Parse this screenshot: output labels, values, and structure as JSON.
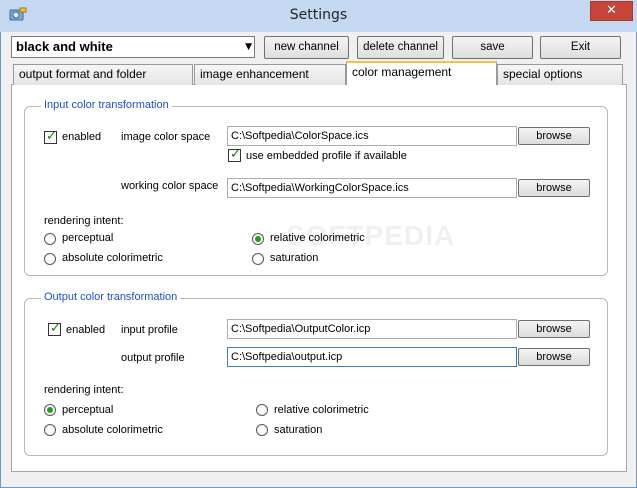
{
  "window": {
    "title": "Settings",
    "close_label": "✕"
  },
  "toolbar": {
    "channel_value": "black and white",
    "new_channel": "new channel",
    "delete_channel": "delete channel",
    "save": "save",
    "exit": "Exit"
  },
  "tabs": [
    {
      "label": "output format and folder",
      "active": false
    },
    {
      "label": "image enhancement",
      "active": false
    },
    {
      "label": "color management",
      "active": true
    },
    {
      "label": "special options",
      "active": false
    }
  ],
  "input_group": {
    "legend": "Input color transformation",
    "enabled_label": "enabled",
    "enabled_checked": true,
    "image_color_space_label": "image color space",
    "image_color_space_value": "C:\\Softpedia\\ColorSpace.ics",
    "use_embedded_label": "use embedded profile if available",
    "use_embedded_checked": true,
    "working_color_space_label": "working color space",
    "working_color_space_value": "C:\\Softpedia\\WorkingColorSpace.ics",
    "browse_label": "browse",
    "rendering_intent_label": "rendering intent:",
    "intents": {
      "perceptual": "perceptual",
      "relative": "relative colorimetric",
      "absolute": "absolute colorimetric",
      "saturation": "saturation"
    },
    "selected_intent": "relative colorimetric"
  },
  "output_group": {
    "legend": "Output color transformation",
    "enabled_label": "enabled",
    "enabled_checked": true,
    "input_profile_label": "input profile",
    "input_profile_value": "C:\\Softpedia\\OutputColor.icp",
    "output_profile_label": "output profile",
    "output_profile_value": "C:\\Softpedia\\output.icp",
    "browse_label": "browse",
    "rendering_intent_label": "rendering intent:",
    "intents": {
      "perceptual": "perceptual",
      "relative": "relative colorimetric",
      "absolute": "absolute colorimetric",
      "saturation": "saturation"
    },
    "selected_intent": "perceptual"
  },
  "watermark": "SOFTPEDIA",
  "colors": {
    "legend_blue": "#1f4fd1",
    "check_green": "#1a7a1a",
    "radio_green": "#20a020",
    "titlebar": "#c4d9f1",
    "close_red": "#c7463a"
  }
}
